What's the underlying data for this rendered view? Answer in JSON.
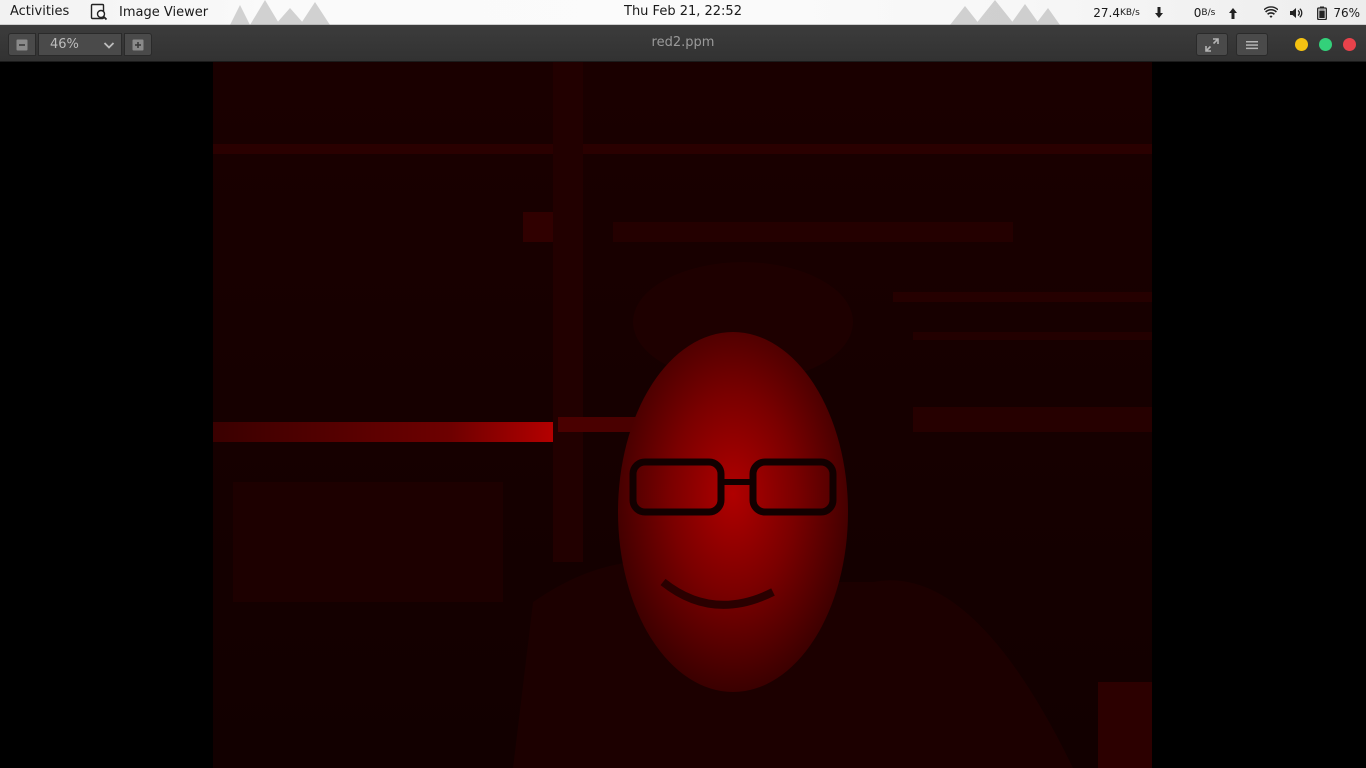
{
  "topbar": {
    "activities_label": "Activities",
    "app_name": "Image Viewer",
    "clock": "Thu Feb 21, 22:52",
    "net_down_value": "27.4",
    "net_down_unit": "KB/s",
    "net_up_value": "0",
    "net_up_unit": "B/s",
    "battery_percent": "76%",
    "icons": [
      "image-viewer-app-icon",
      "download-arrow-icon",
      "upload-arrow-icon",
      "wifi-icon",
      "volume-icon",
      "battery-icon"
    ]
  },
  "headerbar": {
    "zoom_value": "46%",
    "document_title": "red2.ppm",
    "icons": [
      "zoom-out-icon",
      "chevron-down-icon",
      "zoom-in-icon",
      "fullscreen-icon",
      "hamburger-menu-icon"
    ],
    "window_button_colors": {
      "minimize": "#f5c211",
      "maximize": "#33d17a",
      "close": "#e8424b"
    }
  },
  "image": {
    "description_color": "#8b0000",
    "background": "#000000"
  }
}
